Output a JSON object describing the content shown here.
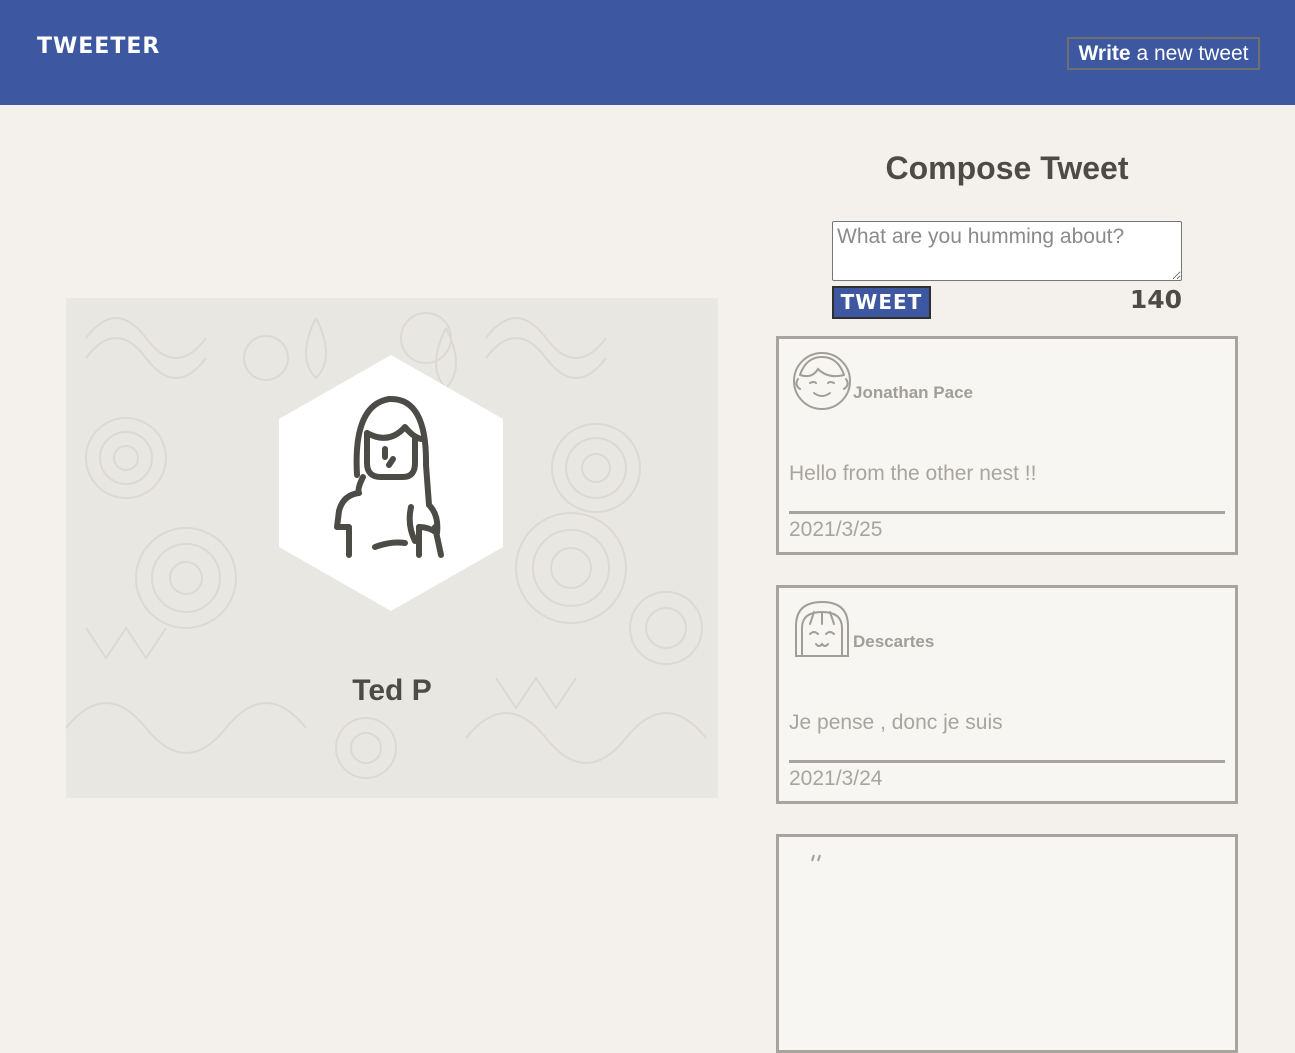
{
  "header": {
    "logo": "TWEETER",
    "write_button": {
      "bold": "Write",
      "rest": " a new tweet"
    }
  },
  "profile": {
    "name": "Ted P"
  },
  "compose": {
    "title": "Compose Tweet",
    "placeholder": "What are you humming about?",
    "button_label": "TWEET",
    "char_count": "140"
  },
  "tweets": [
    {
      "author": "Jonathan Pace",
      "text": "Hello from the other nest !!",
      "date": "2021/3/25"
    },
    {
      "author": "Descartes",
      "text": "Je pense , donc je suis",
      "date": "2021/3/24"
    },
    {
      "author": "",
      "text": "",
      "date": ""
    }
  ]
}
